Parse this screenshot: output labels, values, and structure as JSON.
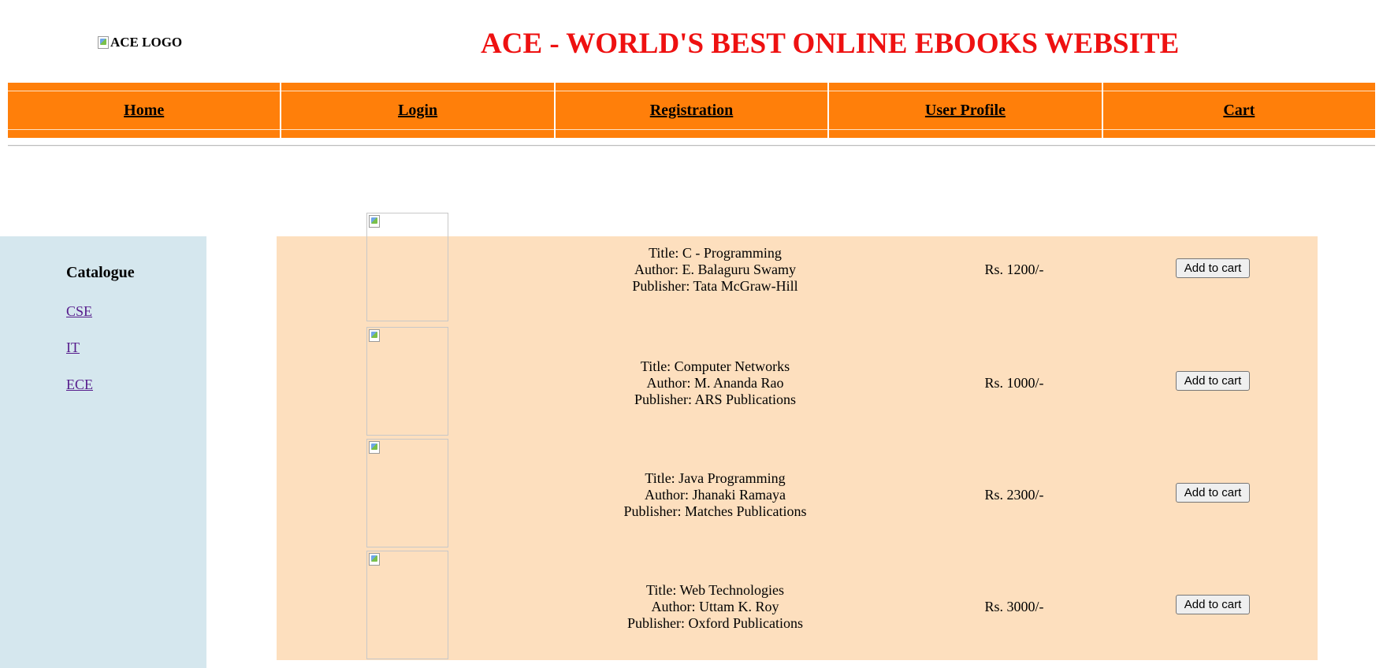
{
  "header": {
    "logo_alt": "ACE LOGO",
    "title": "ACE - WORLD'S BEST ONLINE EBOOKS WEBSITE"
  },
  "nav": {
    "items": [
      {
        "label": "Home"
      },
      {
        "label": "Login"
      },
      {
        "label": "Registration"
      },
      {
        "label": "User Profile"
      },
      {
        "label": "Cart"
      }
    ]
  },
  "sidebar": {
    "title": "Catalogue",
    "links": [
      {
        "label": "CSE"
      },
      {
        "label": "IT"
      },
      {
        "label": "ECE"
      }
    ]
  },
  "books": [
    {
      "title": "Title: C - Programming",
      "author": "Author: E. Balaguru Swamy",
      "publisher": "Publisher: Tata McGraw-Hill",
      "price": "Rs. 1200/-",
      "button": "Add to cart"
    },
    {
      "title": "Title: Computer Networks",
      "author": "Author: M. Ananda Rao",
      "publisher": "Publisher: ARS Publications",
      "price": "Rs. 1000/-",
      "button": "Add to cart"
    },
    {
      "title": "Title: Java Programming",
      "author": "Author: Jhanaki Ramaya",
      "publisher": "Publisher: Matches Publications",
      "price": "Rs. 2300/-",
      "button": "Add to cart"
    },
    {
      "title": "Title: Web Technologies",
      "author": "Author: Uttam K. Roy",
      "publisher": "Publisher: Oxford Publications",
      "price": "Rs. 3000/-",
      "button": "Add to cart"
    }
  ],
  "colors": {
    "title_red": "#ee1111",
    "nav_orange": "#ff7f0a",
    "sidebar_blue": "#d5e7ee",
    "books_bg": "#fddfbe"
  }
}
